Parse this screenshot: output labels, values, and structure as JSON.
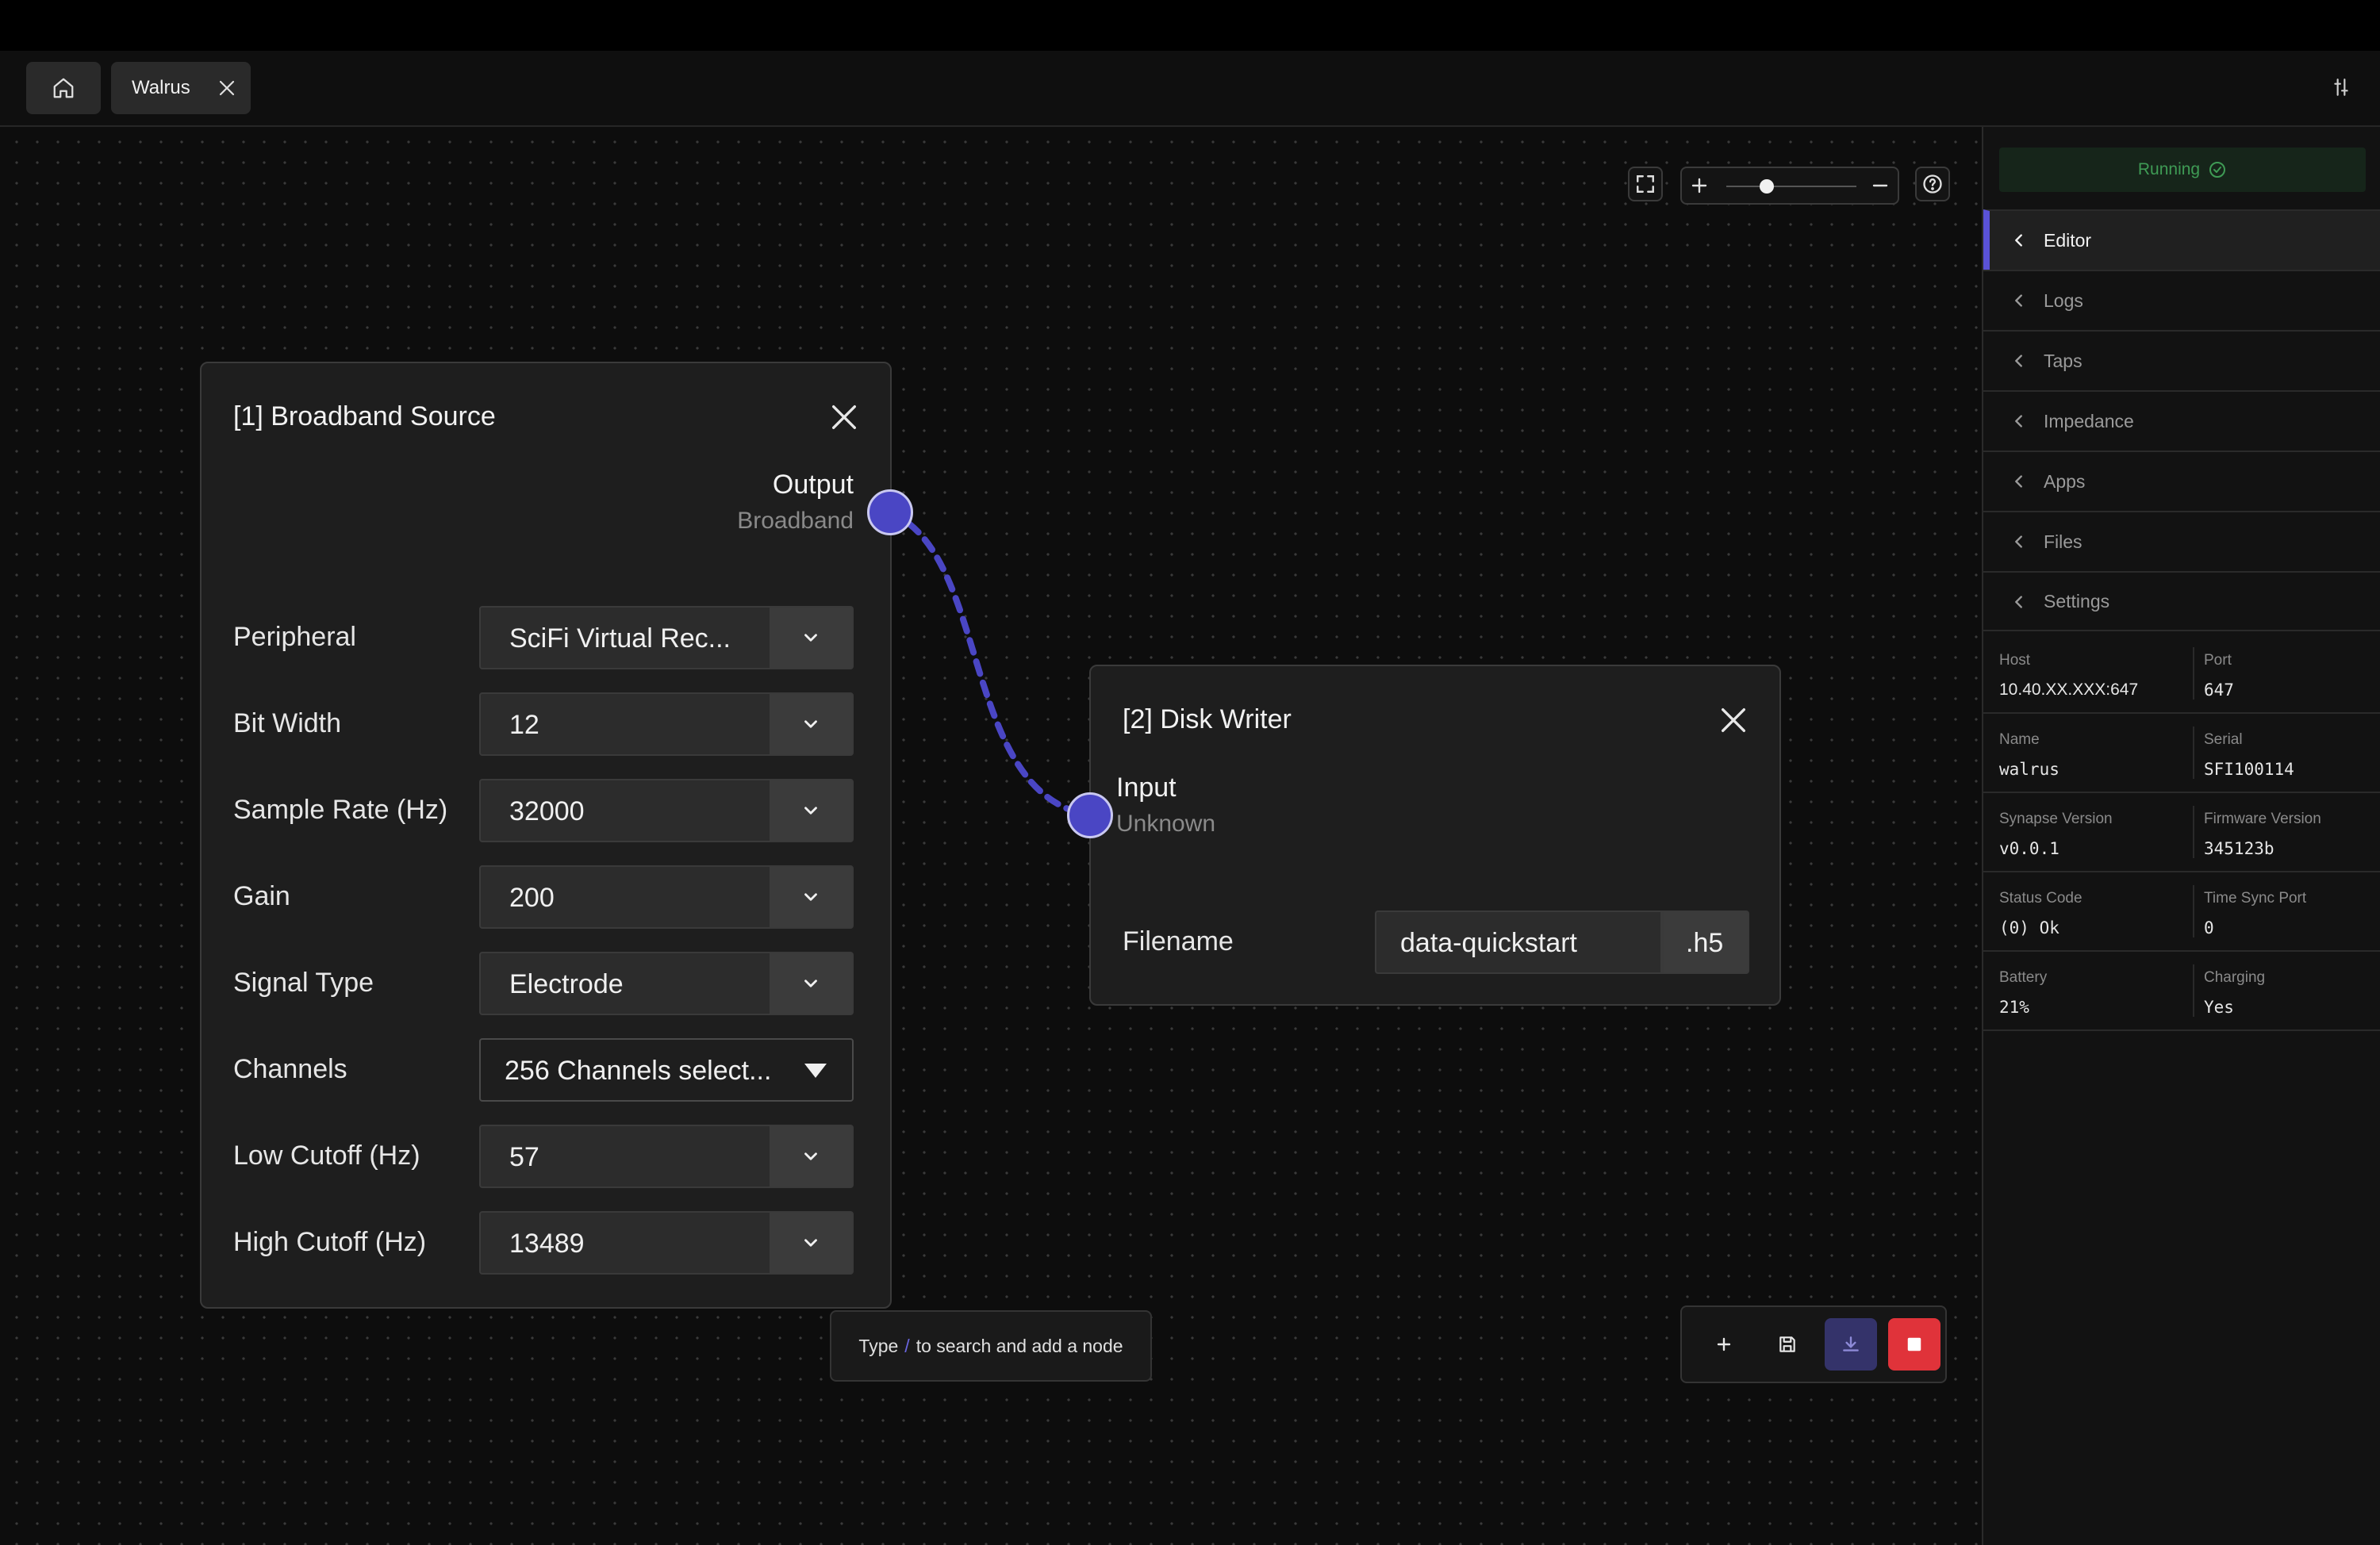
{
  "tabs": {
    "active_label": "Walrus"
  },
  "canvas": {
    "nodes": {
      "source": {
        "title": "[1] Broadband Source",
        "output_label": "Output",
        "output_type": "Broadband",
        "fields": [
          {
            "label": "Peripheral",
            "value": "SciFi Virtual Rec..."
          },
          {
            "label": "Bit Width",
            "value": "12"
          },
          {
            "label": "Sample Rate (Hz)",
            "value": "32000"
          },
          {
            "label": "Gain",
            "value": "200"
          },
          {
            "label": "Signal Type",
            "value": "Electrode"
          },
          {
            "label": "Channels",
            "value": "256 Channels select..."
          },
          {
            "label": "Low Cutoff (Hz)",
            "value": "57"
          },
          {
            "label": "High Cutoff (Hz)",
            "value": "13489"
          }
        ]
      },
      "writer": {
        "title": "[2] Disk Writer",
        "input_label": "Input",
        "input_type": "Unknown",
        "filename_label": "Filename",
        "filename_value": "data-quickstart",
        "extension": ".h5"
      }
    },
    "search_hint": {
      "prefix": "Type",
      "key": "/",
      "suffix": "to search and add a node"
    },
    "link_color": "#4a46c4"
  },
  "sidebar": {
    "status": "Running",
    "nav": [
      "Editor",
      "Logs",
      "Taps",
      "Impedance",
      "Apps",
      "Files",
      "Settings"
    ],
    "info": [
      [
        {
          "label": "Host",
          "value": "10.40.XX.XXX:647"
        },
        {
          "label": "Port",
          "value": "647"
        }
      ],
      [
        {
          "label": "Name",
          "value": "walrus"
        },
        {
          "label": "Serial",
          "value": "SFI100114"
        }
      ],
      [
        {
          "label": "Synapse Version",
          "value": "v0.0.1"
        },
        {
          "label": "Firmware Version",
          "value": "345123b"
        }
      ],
      [
        {
          "label": "Status Code",
          "value": "(0) Ok"
        },
        {
          "label": "Time Sync Port",
          "value": "0"
        }
      ],
      [
        {
          "label": "Battery",
          "value": "21%"
        },
        {
          "label": "Charging",
          "value": "Yes"
        }
      ]
    ]
  },
  "colors": {
    "accent": "#5a52d6",
    "running": "#3f9b55",
    "stop": "#e0333a"
  }
}
